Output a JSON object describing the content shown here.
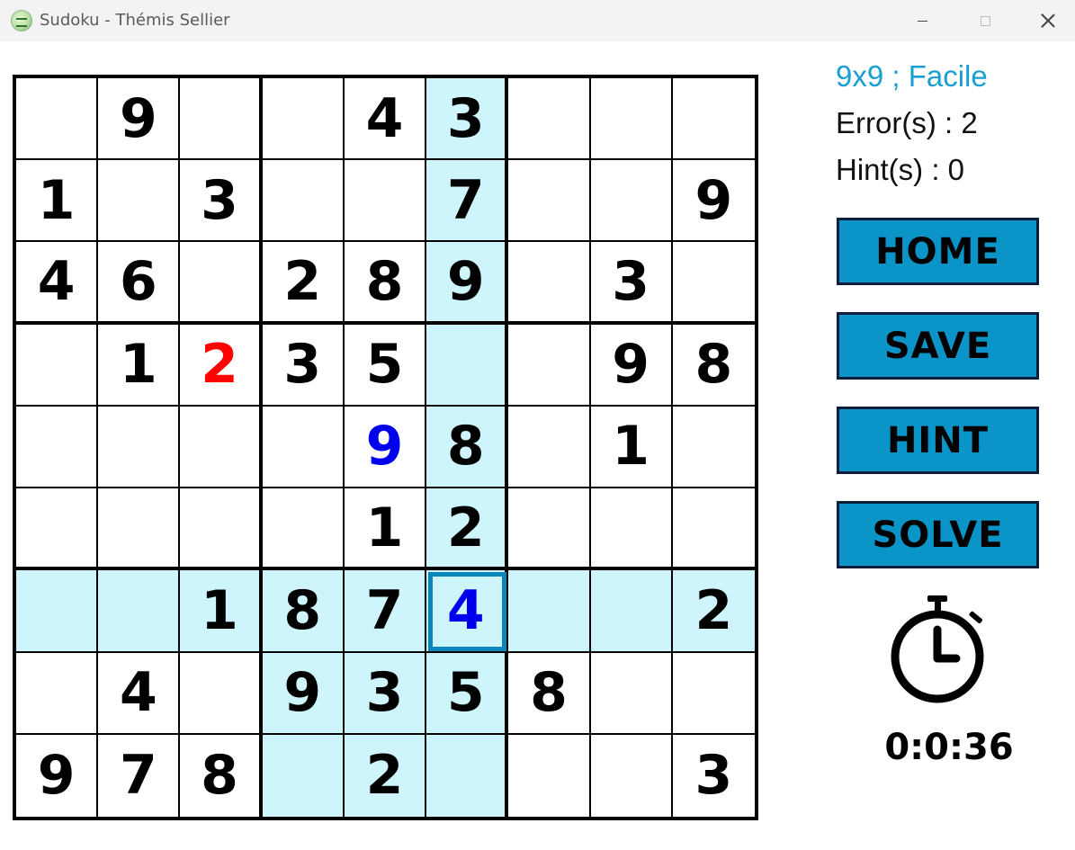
{
  "window": {
    "title": "Sudoku - Thémis Sellier"
  },
  "icons": {
    "app": "sudoku-app-icon",
    "minimize": "minimize-icon",
    "maximize": "maximize-icon",
    "close": "close-icon",
    "timer": "stopwatch-icon"
  },
  "colors": {
    "highlight": "#cdf5fb",
    "accent": "#1a9fd2",
    "button": "#0a94c7",
    "error_digit": "#ff0000",
    "user_digit": "#0000ee",
    "selected_border": "#0c86b8"
  },
  "info": {
    "mode": "9x9 ; Facile",
    "errors": "Error(s) : 2",
    "hints": "Hint(s) : 0"
  },
  "buttons": {
    "home": "HOME",
    "save": "SAVE",
    "hint": "HINT",
    "solve": "SOLVE"
  },
  "timer": "0:0:36",
  "board": {
    "size": 9,
    "selected": {
      "row": 6,
      "col": 5
    },
    "rows": [
      [
        "",
        "9",
        "",
        "",
        "4",
        "3",
        "",
        "",
        ""
      ],
      [
        "1",
        "",
        "3",
        "",
        "",
        "7",
        "",
        "",
        "9"
      ],
      [
        "4",
        "6",
        "",
        "2",
        "8",
        "9",
        "",
        "3",
        ""
      ],
      [
        "",
        "1",
        "2",
        "3",
        "5",
        "",
        "",
        "9",
        "8"
      ],
      [
        "",
        "",
        "",
        "",
        "9",
        "8",
        "",
        "1",
        ""
      ],
      [
        "",
        "",
        "",
        "",
        "1",
        "2",
        "",
        "",
        ""
      ],
      [
        "",
        "",
        "1",
        "8",
        "7",
        "4",
        "",
        "",
        "2"
      ],
      [
        "",
        "4",
        "",
        "9",
        "3",
        "5",
        "8",
        "",
        ""
      ],
      [
        "9",
        "7",
        "8",
        "",
        "2",
        "",
        "",
        "",
        "3"
      ]
    ],
    "cell_style": [
      [
        "",
        "",
        "",
        "",
        "",
        "",
        "",
        "",
        ""
      ],
      [
        "",
        "",
        "",
        "",
        "",
        "",
        "",
        "",
        ""
      ],
      [
        "",
        "",
        "",
        "",
        "",
        "",
        "",
        "",
        ""
      ],
      [
        "",
        "",
        "error",
        "",
        "",
        "",
        "",
        "",
        ""
      ],
      [
        "",
        "",
        "",
        "",
        "user",
        "",
        "",
        "",
        ""
      ],
      [
        "",
        "",
        "",
        "",
        "",
        "",
        "",
        "",
        ""
      ],
      [
        "",
        "",
        "",
        "",
        "",
        "user",
        "",
        "",
        ""
      ],
      [
        "",
        "",
        "",
        "",
        "",
        "",
        "",
        "",
        ""
      ],
      [
        "",
        "",
        "",
        "",
        "",
        "",
        "",
        "",
        ""
      ]
    ],
    "highlighted": [
      [
        0,
        5
      ],
      [
        1,
        5
      ],
      [
        2,
        5
      ],
      [
        3,
        5
      ],
      [
        4,
        5
      ],
      [
        5,
        5
      ],
      [
        6,
        0
      ],
      [
        6,
        1
      ],
      [
        6,
        2
      ],
      [
        6,
        3
      ],
      [
        6,
        4
      ],
      [
        6,
        5
      ],
      [
        6,
        6
      ],
      [
        6,
        7
      ],
      [
        6,
        8
      ],
      [
        7,
        3
      ],
      [
        7,
        4
      ],
      [
        7,
        5
      ],
      [
        8,
        3
      ],
      [
        8,
        4
      ],
      [
        8,
        5
      ]
    ]
  }
}
